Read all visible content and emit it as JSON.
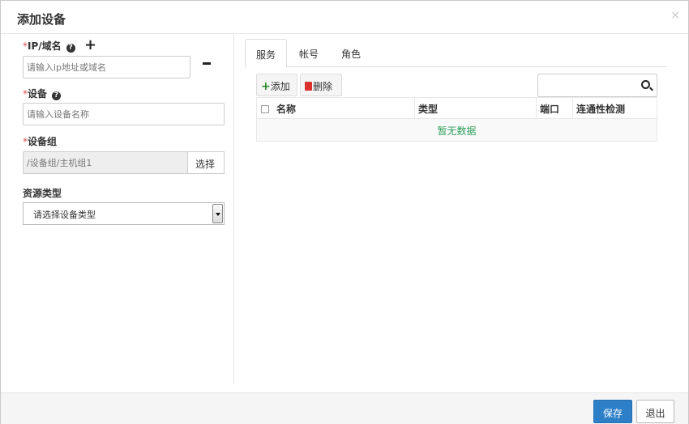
{
  "dialog": {
    "title": "添加设备",
    "close_glyph": "×"
  },
  "form": {
    "ip_field": {
      "required_mark": "*",
      "label": "IP/域名",
      "placeholder": "请输入ip地址或域名",
      "help_icon": "question-circle-icon",
      "add_icon": "plus-icon",
      "remove_icon": "minus-icon"
    },
    "device_field": {
      "required_mark": "*",
      "label": "设备",
      "placeholder": "请输入设备名称",
      "help_icon": "question-circle-icon"
    },
    "group_field": {
      "required_mark": "*",
      "label": "设备组",
      "value": "/设备组/主机组1",
      "select_button": "选择"
    },
    "resource_type": {
      "label": "资源类型",
      "selected": "请选择设备类型"
    }
  },
  "tabs": [
    {
      "label": "服务",
      "active": true
    },
    {
      "label": "帐号",
      "active": false
    },
    {
      "label": "角色",
      "active": false
    }
  ],
  "toolbar": {
    "add_label": "添加",
    "delete_label": "删除",
    "search_value": ""
  },
  "table": {
    "columns": [
      "名称",
      "类型",
      "端口",
      "连通性检测"
    ],
    "empty_text": "暂无数据",
    "rows": []
  },
  "footer": {
    "save_label": "保存",
    "exit_label": "退出"
  },
  "colors": {
    "primary": "#2d7fc8",
    "required": "#d9534f",
    "empty_text": "#2ea05a",
    "add_icon": "#2a8a2a",
    "delete_icon": "#d9302c"
  }
}
